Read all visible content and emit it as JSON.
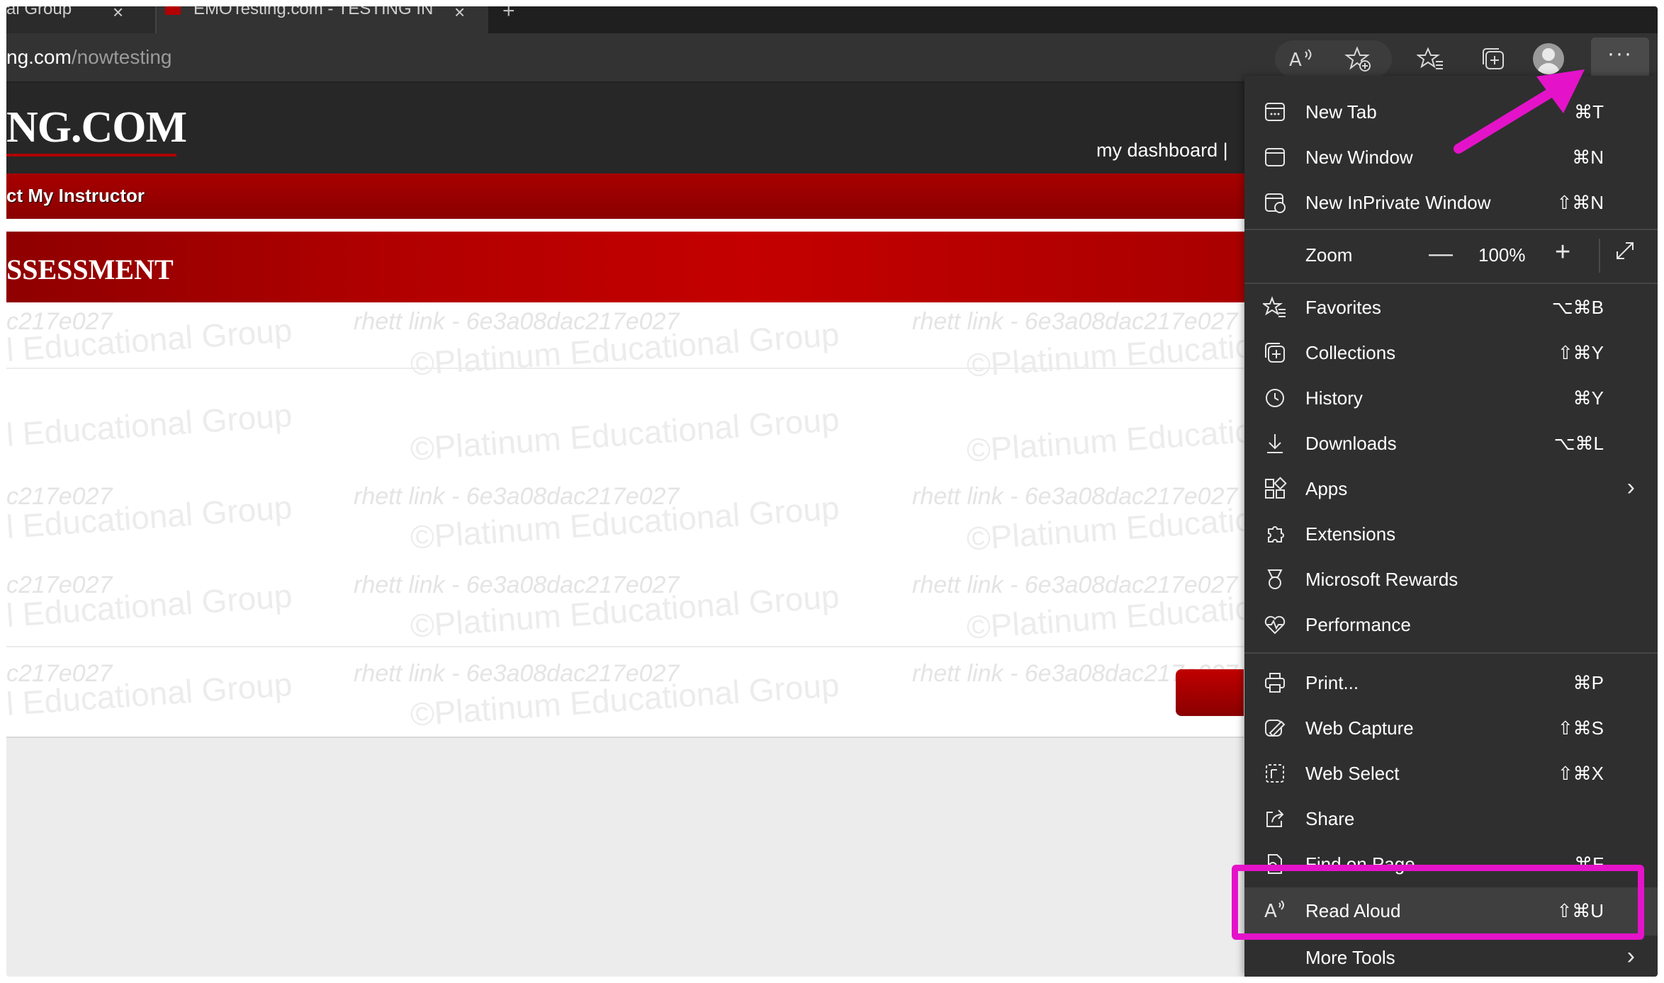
{
  "browser": {
    "tabs": [
      {
        "title": "al Group"
      },
      {
        "title": "EMOTesting.com - TESTING IN"
      }
    ],
    "tab_close_glyph": "×",
    "new_tab_glyph": "+",
    "url_domain": "ng.com",
    "url_path": "/nowtesting",
    "toolbar_icons": [
      "read-aloud-icon",
      "add-favorite-icon",
      "favorites-icon",
      "collections-icon",
      "profile-avatar",
      "more-menu-icon"
    ],
    "more_glyph": "···"
  },
  "site": {
    "logo": "NG.COM",
    "dashboard_link": "my dashboard  |",
    "nav_link": "ct My Instructor",
    "section_title": "SSESSMENT",
    "watermark_link": "rhett link - 6e3a08dac217e027",
    "watermark_link_short": "c217e027",
    "watermark_group": "©Platinum Educational Group",
    "watermark_group_short": "l Educational Group",
    "accent_color": "#b30000"
  },
  "menu": {
    "items": [
      {
        "label": "New Tab",
        "shortcut": "⌘T",
        "icon": "new-tab-icon"
      },
      {
        "label": "New Window",
        "shortcut": "⌘N",
        "icon": "new-window-icon"
      },
      {
        "label": "New InPrivate Window",
        "shortcut": "⇧⌘N",
        "icon": "inprivate-icon"
      },
      {
        "label": "Favorites",
        "shortcut": "⌥⌘B",
        "icon": "favorites-icon"
      },
      {
        "label": "Collections",
        "shortcut": "⇧⌘Y",
        "icon": "collections-icon"
      },
      {
        "label": "History",
        "shortcut": "⌘Y",
        "icon": "history-icon"
      },
      {
        "label": "Downloads",
        "shortcut": "⌥⌘L",
        "icon": "download-icon"
      },
      {
        "label": "Apps",
        "shortcut": "",
        "icon": "apps-icon"
      },
      {
        "label": "Extensions",
        "shortcut": "",
        "icon": "extensions-icon"
      },
      {
        "label": "Microsoft Rewards",
        "shortcut": "",
        "icon": "rewards-icon"
      },
      {
        "label": "Performance",
        "shortcut": "",
        "icon": "performance-icon"
      },
      {
        "label": "Print...",
        "shortcut": "⌘P",
        "icon": "print-icon"
      },
      {
        "label": "Web Capture",
        "shortcut": "⇧⌘S",
        "icon": "web-capture-icon"
      },
      {
        "label": "Web Select",
        "shortcut": "⇧⌘X",
        "icon": "web-select-icon"
      },
      {
        "label": "Share",
        "shortcut": "",
        "icon": "share-icon"
      },
      {
        "label": "Find on Page...",
        "shortcut": "⌘F",
        "icon": "find-icon"
      },
      {
        "label": "Read Aloud",
        "shortcut": "⇧⌘U",
        "icon": "read-aloud-icon"
      },
      {
        "label": "More Tools",
        "shortcut": "",
        "icon": ""
      }
    ],
    "zoom": {
      "label": "Zoom",
      "value": "100%",
      "minus": "—",
      "plus": "+"
    },
    "chevron": "›",
    "highlight_color": "#e413c9"
  }
}
